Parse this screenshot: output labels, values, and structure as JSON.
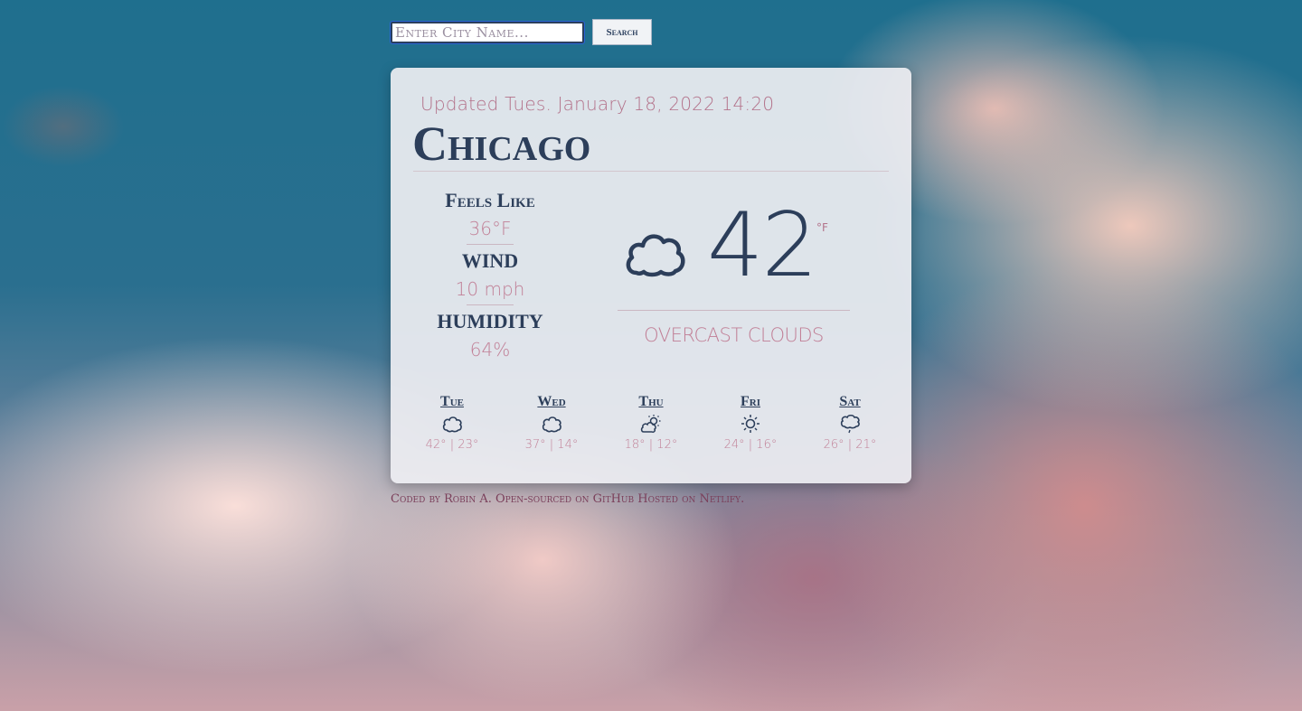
{
  "search": {
    "placeholder": "Enter City Name...",
    "button_label": "Search"
  },
  "current": {
    "updated": "Updated Tues. January 18, 2022 14:20",
    "city": "Chicago",
    "feels_like_label": "Feels Like",
    "feels_like_value": "36°F",
    "wind_label": "WIND",
    "wind_value": "10 mph",
    "humidity_label": "HUMIDITY",
    "humidity_value": "64%",
    "temperature": "42",
    "unit": "°F",
    "description": "overcast clouds",
    "icon": "cloud-icon"
  },
  "forecast": [
    {
      "day": "Tue",
      "icon": "cloud-icon",
      "temps": "42° | 23°"
    },
    {
      "day": "Wed",
      "icon": "cloud-icon",
      "temps": "37° | 14°"
    },
    {
      "day": "Thu",
      "icon": "partly-cloudy-icon",
      "temps": "18° | 12°"
    },
    {
      "day": "Fri",
      "icon": "sun-icon",
      "temps": "24° | 16°"
    },
    {
      "day": "Sat",
      "icon": "cloud-drizzle-icon",
      "temps": "26° | 21°"
    }
  ],
  "footer": {
    "coded_by": "Coded by Robin A.",
    "open_source": "Open-sourced on GitHub",
    "hosted": "Hosted on Netlify."
  },
  "colors": {
    "navy": "#2c3e5a",
    "rose": "#c17f96",
    "footer": "#7a3f5a"
  }
}
